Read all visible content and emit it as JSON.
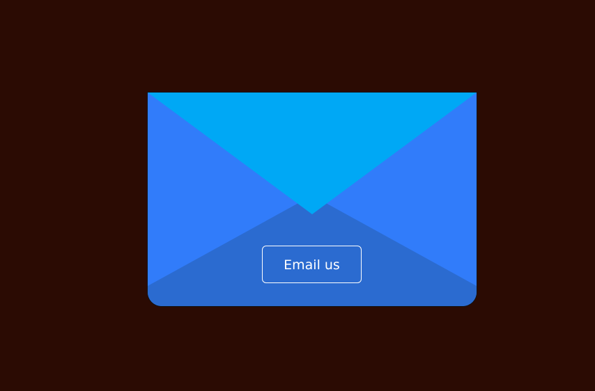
{
  "envelope": {
    "button_label": "Email us",
    "colors": {
      "background": "#2b0b03",
      "side_flaps": "#317cfa",
      "bottom_flap": "#2b6bd0",
      "top_flap": "#00a8f5",
      "button_border": "#ffffff",
      "button_text": "#ffffff"
    },
    "icons": [
      "envelope-icon"
    ]
  }
}
